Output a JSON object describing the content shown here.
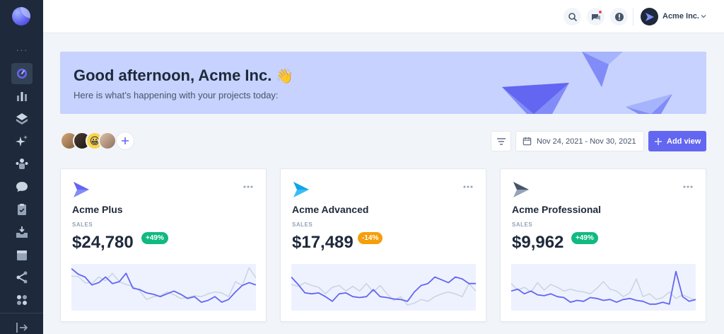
{
  "header": {
    "user_name": "Acme Inc.",
    "icons": [
      "search-icon",
      "chat-icon",
      "info-icon"
    ]
  },
  "sidebar": {
    "items": [
      "dashboard",
      "analytics",
      "layers",
      "sparkles",
      "community",
      "messages",
      "tasks",
      "inbox",
      "calendar",
      "integrations",
      "utility",
      "expand"
    ],
    "active": "dashboard"
  },
  "banner": {
    "title": "Good afternoon, Acme Inc.",
    "emoji": "👋",
    "subtitle": "Here is what’s happening with your projects today:"
  },
  "toolbar": {
    "date_range": "Nov 24, 2021 - Nov 30, 2021",
    "add_view_label": "Add view"
  },
  "cards": [
    {
      "title": "Acme Plus",
      "sales_label": "SALES",
      "value": "$24,780",
      "badge": "+49%",
      "badge_color": "#10b981",
      "icon_color": "#6366f1",
      "chart_data": {
        "type": "line",
        "series": [
          {
            "values": [
              0.9,
              0.78,
              0.72,
              0.55,
              0.6,
              0.72,
              0.58,
              0.62,
              0.8,
              0.48,
              0.45,
              0.38,
              0.35,
              0.3,
              0.36,
              0.42,
              0.35,
              0.26,
              0.3,
              0.18,
              0.22,
              0.3,
              0.18,
              0.24,
              0.4,
              0.54,
              0.6,
              0.55
            ]
          },
          {
            "values": [
              0.74,
              0.73,
              0.6,
              0.58,
              0.72,
              0.64,
              0.8,
              0.62,
              0.56,
              0.52,
              0.42,
              0.24,
              0.3,
              0.32,
              0.4,
              0.34,
              0.26,
              0.28,
              0.32,
              0.3,
              0.36,
              0.4,
              0.38,
              0.3,
              0.62,
              0.54,
              0.92,
              0.7
            ]
          }
        ]
      }
    },
    {
      "title": "Acme Advanced",
      "sales_label": "SALES",
      "value": "$17,489",
      "badge": "-14%",
      "badge_color": "#f59e0b",
      "icon_color": "#0ea5e9",
      "chart_data": {
        "type": "line",
        "series": [
          {
            "values": [
              0.72,
              0.56,
              0.38,
              0.36,
              0.38,
              0.3,
              0.2,
              0.36,
              0.38,
              0.3,
              0.28,
              0.3,
              0.45,
              0.3,
              0.28,
              0.25,
              0.24,
              0.2,
              0.4,
              0.54,
              0.58,
              0.72,
              0.66,
              0.6,
              0.72,
              0.68,
              0.58,
              0.58
            ]
          },
          {
            "values": [
              0.56,
              0.52,
              0.6,
              0.54,
              0.5,
              0.36,
              0.5,
              0.54,
              0.42,
              0.52,
              0.42,
              0.58,
              0.4,
              0.54,
              0.36,
              0.22,
              0.3,
              0.12,
              0.16,
              0.24,
              0.2,
              0.3,
              0.36,
              0.4,
              0.36,
              0.3,
              0.58,
              0.42
            ]
          }
        ]
      }
    },
    {
      "title": "Acme Professional",
      "sales_label": "SALES",
      "value": "$9,962",
      "badge": "+49%",
      "badge_color": "#10b981",
      "icon_color": "#64748b",
      "chart_data": {
        "type": "line",
        "series": [
          {
            "values": [
              0.42,
              0.46,
              0.36,
              0.42,
              0.34,
              0.32,
              0.36,
              0.3,
              0.28,
              0.18,
              0.22,
              0.2,
              0.28,
              0.26,
              0.22,
              0.24,
              0.18,
              0.24,
              0.26,
              0.22,
              0.2,
              0.14,
              0.14,
              0.18,
              0.14,
              0.84,
              0.3,
              0.2,
              0.24
            ]
          },
          {
            "values": [
              0.58,
              0.44,
              0.5,
              0.4,
              0.6,
              0.44,
              0.56,
              0.5,
              0.42,
              0.46,
              0.42,
              0.4,
              0.36,
              0.48,
              0.62,
              0.46,
              0.42,
              0.3,
              0.38,
              0.68,
              0.3,
              0.36,
              0.24,
              0.28,
              0.4,
              0.26,
              0.34,
              0.28,
              0.22
            ]
          }
        ]
      }
    }
  ]
}
